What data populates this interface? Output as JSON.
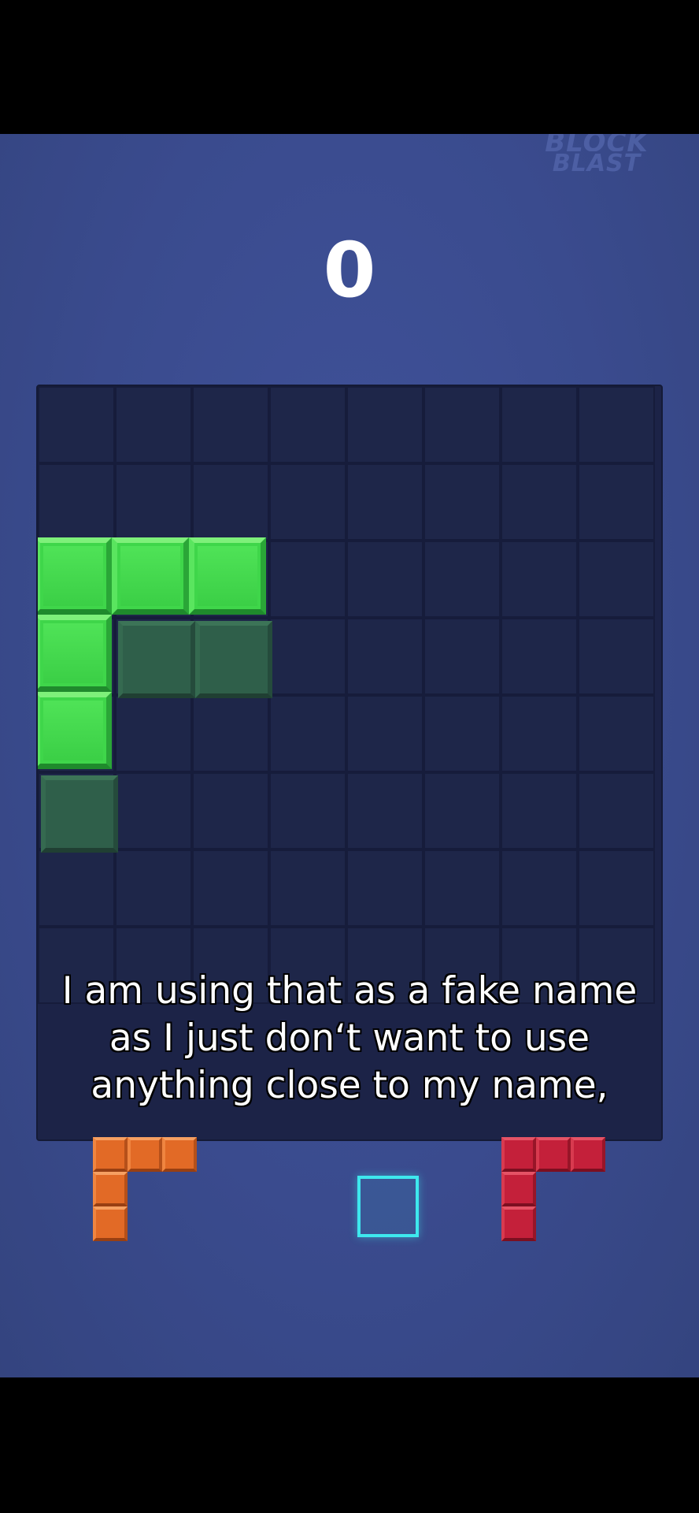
{
  "app": {
    "logo_top": "BLOCK",
    "logo_bottom": "BLAST"
  },
  "score": {
    "value": "0"
  },
  "board": {
    "columns": 8,
    "rows": 8,
    "placed_piece_color": "green",
    "colors": {
      "board_bg": "#1c2347",
      "green": "#3fd64a",
      "ghost": "#2f5f4a",
      "orange": "#e26a26",
      "red": "#c4203a",
      "slot_outline": "#3ee8ee"
    }
  },
  "caption": {
    "line1": "I am using that as a fake name",
    "line2": "as I just don‘t want to use",
    "line3": "anything close to my name,"
  },
  "tray": {
    "pieces": [
      {
        "name": "orange-l-piece",
        "color": "orange",
        "shape": "L"
      },
      {
        "name": "empty-slot-marker",
        "color": "cyan",
        "shape": "outline"
      },
      {
        "name": "red-l-piece",
        "color": "red",
        "shape": "L"
      }
    ]
  }
}
